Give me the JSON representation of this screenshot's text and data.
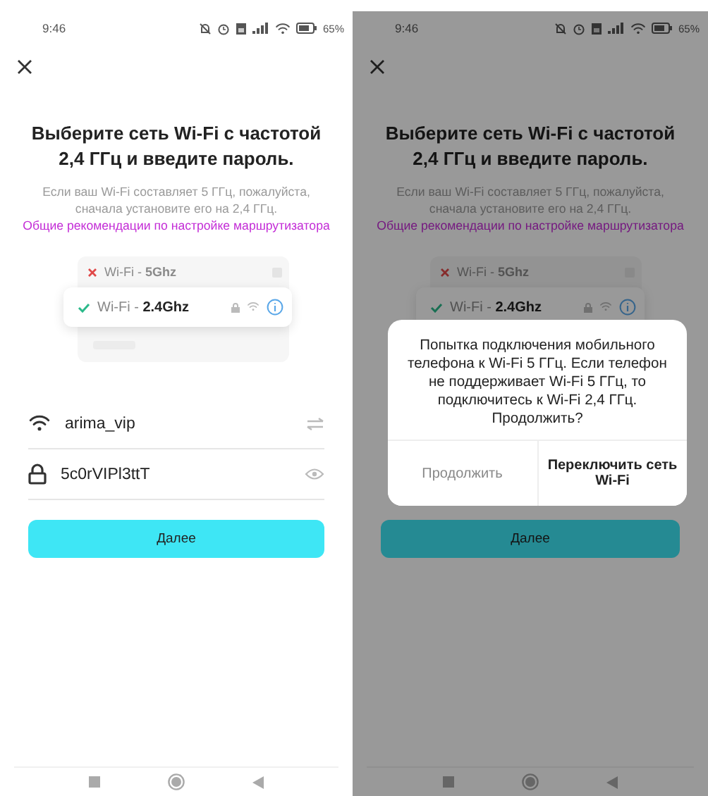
{
  "screens": [
    {
      "status_bar": {
        "time": "9:46",
        "battery": "65%"
      },
      "title": "Выберите сеть Wi-Fi с частотой 2,4 ГГц и введите пароль.",
      "description": "Если ваш Wi-Fi составляет 5 ГГц, пожалуйста, сначала установите его на 2,4 ГГц.",
      "link": "Общие рекомендации по настройке маршрутизатора",
      "networks": [
        {
          "label": "Wi-Fi - **5Ghz**",
          "selected": false
        },
        {
          "label": "Wi-Fi - **2.4Ghz**",
          "selected": true
        }
      ],
      "fields": [
        {
          "kind": "network",
          "value": "arima_vip"
        },
        {
          "kind": "password",
          "value": "5c0rVIPl3ttT"
        }
      ],
      "button": "Далее",
      "dimmed": false
    },
    {
      "status_bar": {
        "time": "9:46",
        "battery": "65%"
      },
      "title": "Выберите сеть Wi-Fi с частотой 2,4 ГГц и введите пароль.",
      "description": "Если ваш Wi-Fi составляет 5 ГГц, пожалуйста, сначала установите его на 2,4 ГГц.",
      "link": "Общие рекомендации по настройке маршрутизатора",
      "networks": [
        {
          "label": "Wi-Fi - **5Ghz**",
          "selected": false
        },
        {
          "label": "Wi-Fi - **2.4Ghz**",
          "selected": true
        }
      ],
      "button": "Далее",
      "dimmed": true,
      "dialog": {
        "message": "Попытка подключения мобильного телефона к Wi-Fi 5 ГГц. Если телефон не поддерживает Wi-Fi 5 ГГц, то подключитесь к Wi-Fi 2,4 ГГц. Продолжить?",
        "buttons": [
          {
            "label": "Продолжить",
            "kind": "secondary"
          },
          {
            "label": "Переключить сеть Wi-Fi",
            "kind": "primary"
          }
        ]
      }
    }
  ]
}
